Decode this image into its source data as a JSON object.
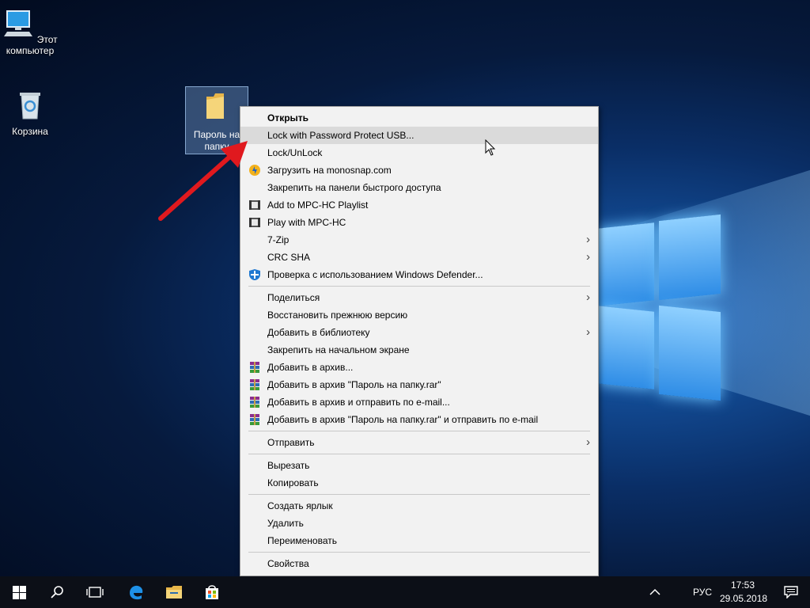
{
  "desktop": {
    "icons": [
      {
        "label": "Этот компьютер"
      },
      {
        "label": "Корзина"
      }
    ],
    "selected_item": {
      "label": "Пароль на папку"
    }
  },
  "context_menu": {
    "groups": [
      [
        {
          "label": "Открыть",
          "bold": true
        },
        {
          "label": "Lock with Password Protect USB...",
          "highlighted": true
        },
        {
          "label": "Lock/UnLock"
        },
        {
          "label": "Загрузить на monosnap.com",
          "icon": "monosnap-icon"
        },
        {
          "label": "Закрепить на панели быстрого доступа"
        },
        {
          "label": "Add to MPC-HC Playlist",
          "icon": "mpc-hc-icon"
        },
        {
          "label": "Play with MPC-HC",
          "icon": "mpc-hc-icon"
        },
        {
          "label": "7-Zip",
          "submenu": true
        },
        {
          "label": "CRC SHA",
          "submenu": true
        },
        {
          "label": "Проверка с использованием Windows Defender...",
          "icon": "windows-defender-icon"
        }
      ],
      [
        {
          "label": "Поделиться",
          "submenu": true
        },
        {
          "label": "Восстановить прежнюю версию"
        },
        {
          "label": "Добавить в библиотеку",
          "submenu": true
        },
        {
          "label": "Закрепить на начальном экране"
        },
        {
          "label": "Добавить в архив...",
          "icon": "winrar-icon"
        },
        {
          "label": "Добавить в архив \"Пароль на папку.rar\"",
          "icon": "winrar-icon"
        },
        {
          "label": "Добавить в архив и отправить по e-mail...",
          "icon": "winrar-icon"
        },
        {
          "label": "Добавить в архив \"Пароль на папку.rar\" и отправить по e-mail",
          "icon": "winrar-icon"
        }
      ],
      [
        {
          "label": "Отправить",
          "submenu": true
        }
      ],
      [
        {
          "label": "Вырезать"
        },
        {
          "label": "Копировать"
        }
      ],
      [
        {
          "label": "Создать ярлык"
        },
        {
          "label": "Удалить"
        },
        {
          "label": "Переименовать"
        }
      ],
      [
        {
          "label": "Свойства"
        }
      ]
    ]
  },
  "taskbar": {
    "buttons": [
      "start-icon",
      "search-icon",
      "task-view-icon",
      "edge-icon",
      "file-explorer-icon",
      "store-icon"
    ],
    "language": "РУС",
    "time": "17:53",
    "date": "29.05.2018"
  },
  "colors": {
    "menu_bg": "#f2f2f2",
    "menu_highlight": "#dadada",
    "annotation_arrow": "#e0191e",
    "taskbar_bg": "#0c0f17"
  }
}
